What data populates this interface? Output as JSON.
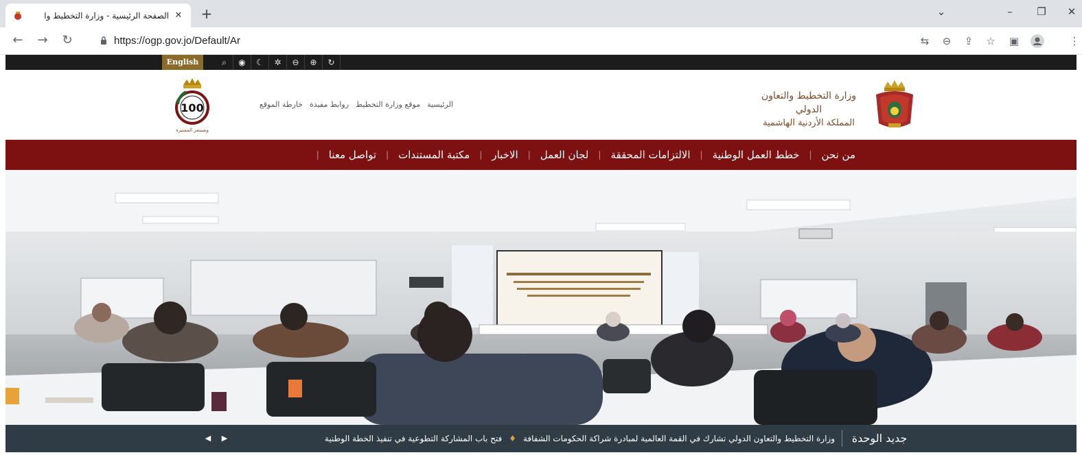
{
  "browser": {
    "tab_title": "الصفحة الرئيسية - وزارة التخطيط وا",
    "tab_close": "✕",
    "new_tab": "+",
    "url": "https://ogp.gov.jo/Default/Ar",
    "window_controls": {
      "dropdown": "⌄",
      "minimize": "–",
      "restore": "❐",
      "close": "✕"
    },
    "toolbar_icons": [
      "translate-icon",
      "zoom-icon",
      "share-icon",
      "bookmark-star-icon",
      "side-panel-icon",
      "profile-icon",
      "menu-icon"
    ]
  },
  "accessibility_bar": {
    "language_label": "English",
    "icons": [
      "search-icon",
      "eye-icon",
      "moon-icon",
      "settings-icon",
      "zoom-out-icon",
      "zoom-in-icon",
      "reset-icon"
    ]
  },
  "header": {
    "top_links": [
      "الرئيسية",
      "موقع وزارة التخطيط",
      "روابط مفيدة",
      "خارطة الموقع"
    ],
    "ministry_line1": "وزارة التخطيط والتعاون الدولي",
    "ministry_line2": "المملكة الأردنية الهاشمية",
    "centenary_number": "100",
    "centenary_caption": "ونستمر المسيرة"
  },
  "main_nav": [
    "من نحن",
    "خطط العمل الوطنية",
    "الالتزامات المحققة",
    "لجان العمل",
    "الاخبار",
    "مكتبة المستندات",
    "تواصل معنا"
  ],
  "ticker": {
    "title": "جديد الوحدة",
    "items": [
      "وزارة التخطيط والتعاون الدولي تشارك في القمة العالمية لمبادرة شراكة الحكومات الشفافة",
      "فتح باب المشاركة التطوعية في تنفيذ الخطة الوطنية"
    ]
  },
  "colors": {
    "nav_bg": "#7d1010",
    "ticker_bg": "#2f3b45",
    "lang_btn": "#8b6b2c",
    "acc_bar": "#1c1c1c"
  }
}
